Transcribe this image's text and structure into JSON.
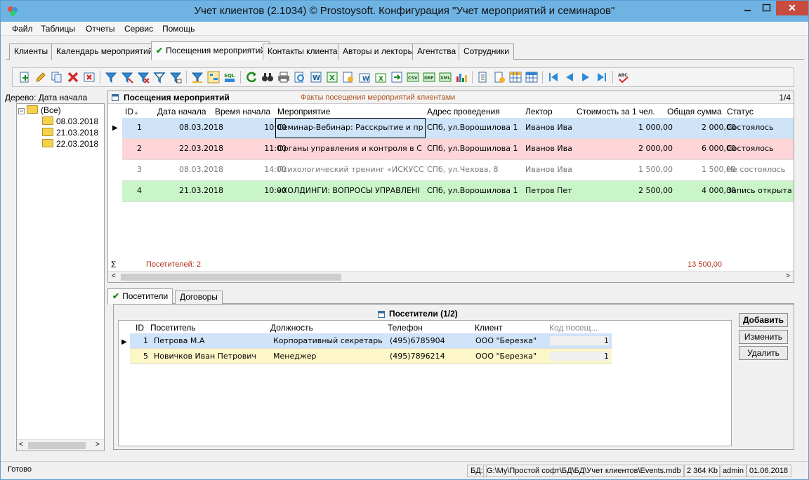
{
  "window": {
    "title": "Учет клиентов (2.1034) © Prostoysoft. Конфигурация \"Учет мероприятий и семинаров\""
  },
  "menu": [
    "Файл",
    "Таблицы",
    "Отчеты",
    "Сервис",
    "Помощь"
  ],
  "tabs": [
    "Клиенты",
    "Календарь мероприятий",
    "Посещения мероприятий",
    "Контакты клиента",
    "Авторы и лекторы",
    "Агентства",
    "Сотрудники"
  ],
  "tree": {
    "label": "Дерево: Дата начала",
    "root": "(Все)",
    "nodes": [
      "08.03.2018",
      "21.03.2018",
      "22.03.2018"
    ]
  },
  "grid": {
    "title": "Посещения мероприятий",
    "subtitle": "Факты посещения мероприятий клиентами",
    "counter": "1/4",
    "columns": [
      "ID",
      "Дата начала",
      "Время начала",
      "Мероприятие",
      "Адрес проведения",
      "Лектор",
      "Стоимость за 1 чел.",
      "Общая сумма",
      "Статус"
    ],
    "rows": [
      {
        "id": "1",
        "date": "08.03.2018",
        "time": "10:00",
        "event": "Семинар-Вебинар: Расскрытие и пр",
        "address": "СПб, ул.Ворошилова 1",
        "lector": "Иванов Ива",
        "price": "1 000,00",
        "total": "2 000,00",
        "status": "Состоялось",
        "bg": "#cfe3f9",
        "fg": "#000000"
      },
      {
        "id": "2",
        "date": "22.03.2018",
        "time": "11:00",
        "event": "Органы управления и контроля в С",
        "address": "СПб, ул.Ворошилова 1",
        "lector": "Иванов Ива",
        "price": "2 000,00",
        "total": "6 000,00",
        "status": "Состоялось",
        "bg": "#fdd5d8",
        "fg": "#000000"
      },
      {
        "id": "3",
        "date": "08.03.2018",
        "time": "14:00",
        "event": "Психологический тренинг «ИСКУСС",
        "address": "СПб, ул.Чехова, 8",
        "lector": "Иванов Ива",
        "price": "1 500,00",
        "total": "1 500,00",
        "status": "Не состоялось",
        "bg": "#ffffff",
        "fg": "#777777"
      },
      {
        "id": "4",
        "date": "21.03.2018",
        "time": "10:00",
        "event": "«ХОЛДИНГИ: ВОПРОСЫ УПРАВЛЕНІ",
        "address": "СПб, ул.Ворошилова 1",
        "lector": "Петров Пет",
        "price": "2 500,00",
        "total": "4 000,00",
        "status": "Запись открыта",
        "bg": "#c9f5c9",
        "fg": "#000000"
      }
    ],
    "sum_symbol": "Σ",
    "sum_label": "Посетителей: 2",
    "sum_total": "13 500,00"
  },
  "subtabs": [
    "Посетители",
    "Договоры"
  ],
  "subgrid": {
    "title": "Посетители (1/2)",
    "columns": [
      "ID",
      "Посетитель",
      "Должность",
      "Телефон",
      "Клиент",
      "Код посещ..."
    ],
    "rows": [
      {
        "id": "1",
        "name": "Петрова М.А",
        "position": "Корпоративный секретарь",
        "phone": "(495)6785904",
        "client": "ООО \"Березка\"",
        "code": "1",
        "bg": "#cfe3f9"
      },
      {
        "id": "5",
        "name": "Новичков Иван Петрович",
        "position": "Менеджер",
        "phone": "(495)7896214",
        "client": "ООО \"Березка\"",
        "code": "1",
        "bg": "#fdf7c7"
      }
    ],
    "buttons": {
      "add": "Добавить",
      "edit": "Изменить",
      "delete": "Удалить"
    }
  },
  "status": {
    "ready": "Готово",
    "db_label": "БД:",
    "db_path": "G:\\My\\Простой софт\\БД\\БД\\Учет клиентов\\Events.mdb",
    "size": "2 364 Kb",
    "user": "admin",
    "date": "01.06.2018"
  },
  "colors": {
    "accent": "#6fb3e3",
    "close": "#c74b3f",
    "sum_text": "#b0301c"
  }
}
